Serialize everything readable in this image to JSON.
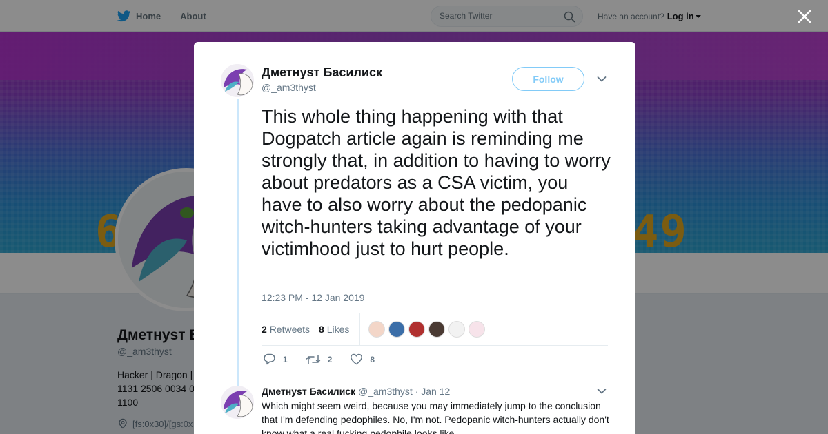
{
  "nav": {
    "home_label": "Home",
    "about_label": "About",
    "search_placeholder": "Search Twitter",
    "account_prompt": "Have an account?",
    "login_label": "Log in"
  },
  "profile": {
    "banner_digits_left": "6",
    "banner_digits_right": "49",
    "name": "Дметнуѕт Б",
    "handle": "@_am3thyst",
    "bio_line1": "Hacker | Dragon |",
    "bio_line2": "1131 2506 0034 0",
    "bio_line3": "1100",
    "location": "[fs:0x30]/[gs:0x"
  },
  "tweet": {
    "author_name": "Дметнуѕт Басилиск",
    "author_handle": "@_am3thyst",
    "follow_label": "Follow",
    "text": "This whole thing happening with that Dogpatch article again is reminding me strongly that, in addition to having to worry about predators as a CSA victim, you have to also worry about the pedopanic witch-hunters taking advantage of your victimhood just to hurt people.",
    "timestamp": "12:23 PM - 12 Jan 2019",
    "retweets_count": "2",
    "retweets_label": "Retweets",
    "likes_count": "8",
    "likes_label": "Likes",
    "reply_count": "1",
    "retweet_count": "2",
    "like_count": "8",
    "likers": [
      "#f3d6c8",
      "#3b6ea8",
      "#b0302f",
      "#4a3a33",
      "#f2f2f2",
      "#f7e3ea"
    ]
  },
  "reply": {
    "author_name": "Дметнуѕт Басилиск",
    "author_handle": "@_am3thyst",
    "separator": "·",
    "date": "Jan 12",
    "text": "Which might seem weird, because you may immediately jump to the conclusion that I'm defending pedophiles. No, I'm not. Pedopanic witch-hunters actually don't know what a real fucking pedophile looks like."
  },
  "colors": {
    "accent": "#1da1f2",
    "text_secondary": "#657786",
    "thread_line": "#cce7fb"
  }
}
